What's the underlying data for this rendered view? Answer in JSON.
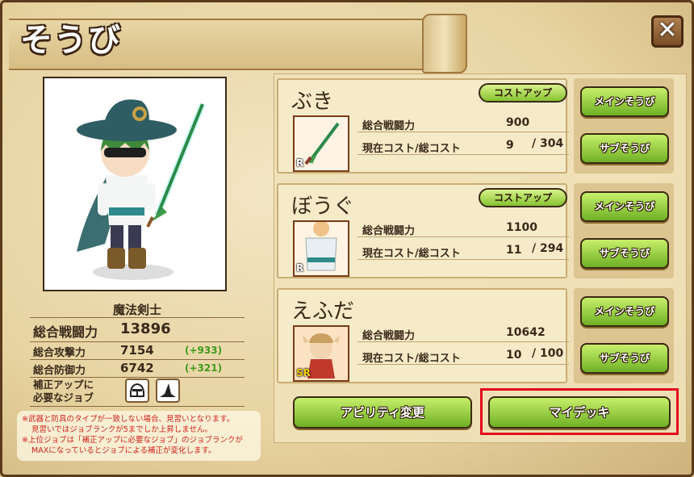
{
  "window": {
    "title": "そうび",
    "close_label": "✕"
  },
  "character": {
    "job": "魔法剣士",
    "stats": {
      "total_power_label": "総合戦闘力",
      "total_power": "13896",
      "attack_label": "総合攻撃力",
      "attack": "7154",
      "attack_bonus": "(+933)",
      "defense_label": "総合防御力",
      "defense": "6742",
      "defense_bonus": "(+321)"
    },
    "needed_jobs_label_1": "補正アップに",
    "needed_jobs_label_2": "必要なジョブ",
    "needed_job_icons": [
      "knight-helmet-icon",
      "witch-hat-icon"
    ]
  },
  "notes": {
    "line1": "※武器と防具のタイプが一致しない場合、見習いとなります。",
    "line2": "見習いではジョブランクが5までしか上昇しません。",
    "line3": "※上位ジョブは「補正アップに必要なジョブ」のジョブランクが",
    "line4": "MAXになっているとジョブによる補正が変化します。"
  },
  "equipment": [
    {
      "title": "ぶき",
      "cost_up": "コストアップ",
      "rarity": "R",
      "power_label": "総合戦闘力",
      "power": "900",
      "cost_label": "現在コスト/総コスト",
      "cost_current": "9",
      "cost_total": "/ 304",
      "main_btn": "メインそうび",
      "sub_btn": "サブそうび"
    },
    {
      "title": "ぼうぐ",
      "cost_up": "コストアップ",
      "rarity": "R",
      "power_label": "総合戦闘力",
      "power": "1100",
      "cost_label": "現在コスト/総コスト",
      "cost_current": "11",
      "cost_total": "/ 294",
      "main_btn": "メインそうび",
      "sub_btn": "サブそうび"
    },
    {
      "title": "えふだ",
      "rarity": "SR",
      "power_label": "総合戦闘力",
      "power": "10642",
      "cost_label": "現在コスト/総コスト",
      "cost_current": "10",
      "cost_total": "/ 100",
      "main_btn": "メインそうび",
      "sub_btn": "サブそうび"
    }
  ],
  "bottom": {
    "ability_btn": "アビリティ変更",
    "mydeck_btn": "マイデッキ"
  },
  "colors": {
    "accent_green": "#86c230",
    "highlight_red": "#e3091a",
    "bonus_green": "#3f9a1d"
  }
}
